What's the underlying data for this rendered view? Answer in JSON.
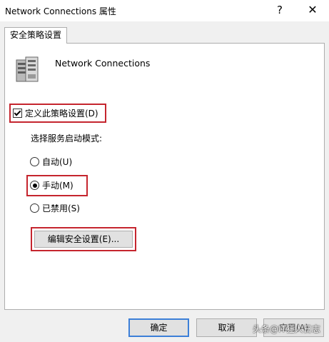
{
  "window": {
    "title": "Network Connections 属性",
    "help_glyph": "?",
    "close_glyph": "✕"
  },
  "tabs": [
    {
      "label": "安全策略设置"
    }
  ],
  "policy": {
    "name": "Network Connections"
  },
  "define_policy": {
    "label": "定义此策略设置(D)",
    "checked": true
  },
  "startup_mode": {
    "label": "选择服务启动模式:",
    "options": [
      {
        "label": "自动(U)",
        "selected": false
      },
      {
        "label": "手动(M)",
        "selected": true
      },
      {
        "label": "已禁用(S)",
        "selected": false
      }
    ]
  },
  "edit_security_label": "编辑安全设置(E)...",
  "footer": {
    "ok": "确定",
    "cancel": "取消",
    "apply": "应用(A)"
  },
  "watermark": "头条@IT狂人日志",
  "colors": {
    "highlight": "#c5252e",
    "default_button_border": "#3c7fd8"
  }
}
